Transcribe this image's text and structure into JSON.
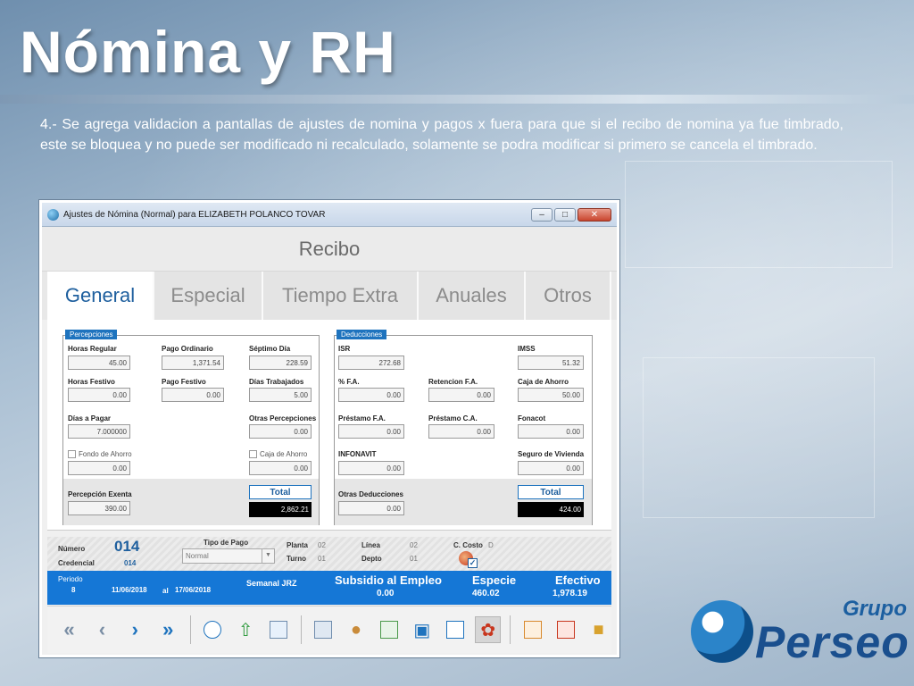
{
  "slide": {
    "title": "Nómina y RH",
    "text": "4.- Se agrega validacion a pantallas de ajustes de nomina y pagos x fuera para que si el recibo de nomina ya fue timbrado, este se bloquea y no puede ser modificado ni recalculado, solamente se podra modificar si primero se cancela el timbrado."
  },
  "window": {
    "title": "Ajustes de Nómina (Normal) para ELIZABETH POLANCO TOVAR",
    "minimize": "–",
    "maximize": "□",
    "close": "✕",
    "header": "Recibo",
    "tabs": [
      "General",
      "Especial",
      "Tiempo Extra",
      "Anuales",
      "Otros"
    ],
    "active_tab": "General"
  },
  "percepciones": {
    "title": "Percepciones",
    "horas_regular": {
      "label": "Horas Regular",
      "value": "45.00"
    },
    "pago_ordinario": {
      "label": "Pago  Ordinario",
      "value": "1,371.54"
    },
    "septimo_dia": {
      "label": "Séptimo Día",
      "value": "228.59"
    },
    "horas_festivo": {
      "label": "Horas Festivo",
      "value": "0.00"
    },
    "pago_festivo": {
      "label": "Pago Festivo",
      "value": "0.00"
    },
    "dias_trabajados": {
      "label": "Días Trabajados",
      "value": "5.00"
    },
    "dias_pagar": {
      "label": "Días a Pagar",
      "value": "7.000000"
    },
    "otras_percepciones": {
      "label": "Otras Percepciones",
      "value": "0.00"
    },
    "fondo_ahorro": {
      "label": "Fondo de Ahorro",
      "value": "0.00"
    },
    "caja_ahorro": {
      "label": "Caja de Ahorro",
      "value": "0.00"
    },
    "percepcion_exenta": {
      "label": "Percepción Exenta",
      "value": "390.00"
    },
    "total_label": "Total",
    "total_value": "2,862.21"
  },
  "deducciones": {
    "title": "Deducciones",
    "isr": {
      "label": "ISR",
      "value": "272.68"
    },
    "imss": {
      "label": "IMSS",
      "value": "51.32"
    },
    "pct_fa": {
      "label": "% F.A.",
      "value": "0.00"
    },
    "retencion_fa": {
      "label": "Retencion F.A.",
      "value": "0.00"
    },
    "caja_ahorro": {
      "label": "Caja de Ahorro",
      "value": "50.00"
    },
    "prestamo_fa": {
      "label": "Préstamo F.A.",
      "value": "0.00"
    },
    "prestamo_ca": {
      "label": "Préstamo C.A.",
      "value": "0.00"
    },
    "fonacot": {
      "label": "Fonacot",
      "value": "0.00"
    },
    "infonavit": {
      "label": "INFONAVIT",
      "value": "0.00"
    },
    "seguro_vivienda": {
      "label": "Seguro de Vivienda",
      "value": "0.00"
    },
    "otras_deducciones": {
      "label": "Otras Deducciones",
      "value": "0.00"
    },
    "total_label": "Total",
    "total_value": "424.00"
  },
  "info": {
    "numero_label": "Número",
    "numero_value": "014",
    "credencial_label": "Credencial",
    "credencial_value": "014",
    "tipo_pago_label": "Tipo de Pago",
    "tipo_pago_value": "Normal",
    "planta_label": "Planta",
    "planta_value": "02",
    "turno_label": "Turno",
    "turno_value": "01",
    "linea_label": "Línea",
    "linea_value": "02",
    "depto_label": "Depto",
    "depto_value": "01",
    "ccosto_label": "C. Costo",
    "ccosto_value": "D"
  },
  "summary": {
    "periodo_label": "Periodo",
    "periodo_value": "8",
    "fecha_inicio": "11/06/2018",
    "al": "al",
    "fecha_fin": "17/06/2018",
    "semanal": "Semanal JRZ",
    "subsidio_label": "Subsidio al Empleo",
    "subsidio_value": "0.00",
    "especie_label": "Especie",
    "especie_value": "460.02",
    "efectivo_label": "Efectivo",
    "efectivo_value": "1,978.19"
  },
  "logo": {
    "grupo": "Grupo",
    "perseo": "Perseo"
  },
  "colors": {
    "accent": "#1577d6",
    "tab_active": "#1e5f9e"
  }
}
